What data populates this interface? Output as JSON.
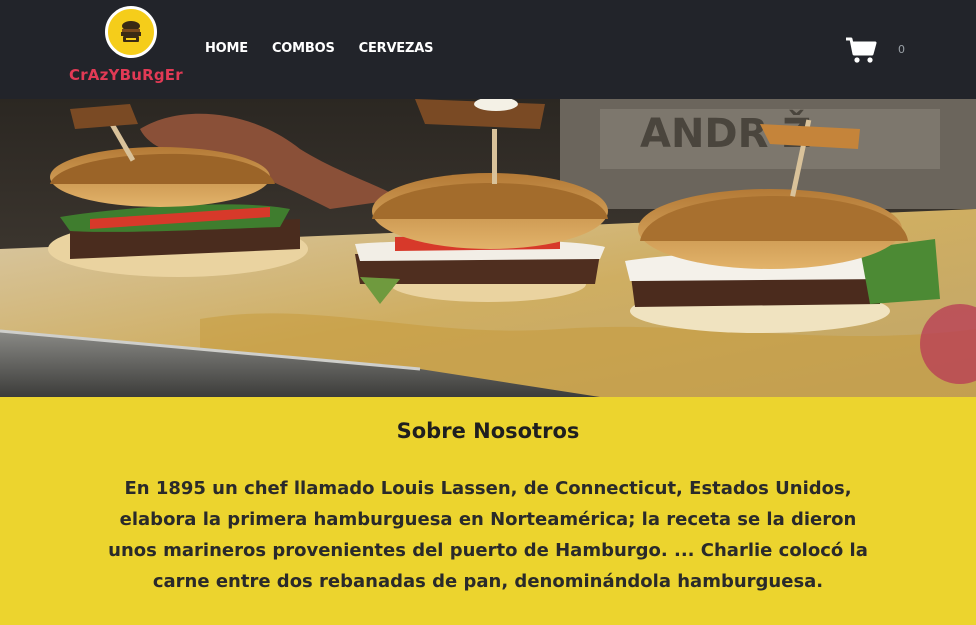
{
  "brand": {
    "name": "CrAzYBuRgEr",
    "logo_icon": "burger-logo-icon",
    "brand_color": "#e23a55",
    "logo_color": "#f5cd1a"
  },
  "nav": {
    "items": [
      {
        "label": "HOME"
      },
      {
        "label": "COMBOS"
      },
      {
        "label": "CERVEZAS"
      }
    ]
  },
  "cart": {
    "icon": "shopping-cart-icon",
    "count": "0"
  },
  "hero": {
    "image": "three-burgers-photo"
  },
  "about": {
    "title": "Sobre Nosotros",
    "text": "En 1895 un chef llamado Louis Lassen, de Connecticut, Estados Unidos, elabora la primera hamburguesa en Norteamérica; la receta se la dieron unos marineros provenientes del puerto de Hamburgo. ... Charlie colocó la carne entre dos rebanadas de pan, denominándola hamburguesa.",
    "background": "#ecd42e"
  },
  "colors": {
    "navbar": "#22242a",
    "accent_yellow": "#ecd42e"
  }
}
